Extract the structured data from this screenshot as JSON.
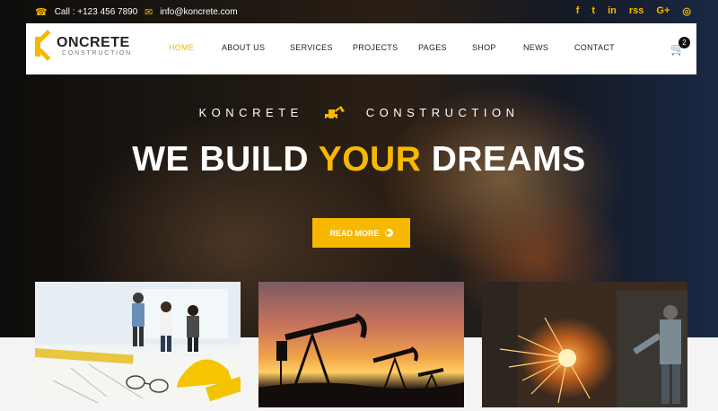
{
  "topbar": {
    "phone": "Call : +123 456 7890",
    "email": "info@koncrete.com",
    "social_icons": [
      "facebook-icon",
      "twitter-icon",
      "linkedin-icon",
      "rss-icon",
      "google-plus-icon",
      "dribbble-icon"
    ],
    "social_glyphs": [
      "f",
      "t",
      "in",
      "rss",
      "G+",
      "◎"
    ]
  },
  "logo": {
    "name": "ONCRETE",
    "sub": "CONSTRUCTION"
  },
  "nav": {
    "items": [
      {
        "label": "HOME",
        "active": true
      },
      {
        "label": "ABOUT US"
      },
      {
        "label": "SERVICES"
      },
      {
        "label": "PROJECTS"
      },
      {
        "label": "PAGES"
      },
      {
        "label": "SHOP"
      },
      {
        "label": "NEWS"
      },
      {
        "label": "CONTACT"
      }
    ],
    "cart_count": "2"
  },
  "hero": {
    "tagline_left": "KONCRETE",
    "tagline_right": "CONSTRUCTION",
    "headline_pre": "WE BUILD ",
    "headline_accent": "YOUR",
    "headline_post": " DREAMS",
    "button": "READ MORE"
  },
  "colors": {
    "accent": "#f6b800",
    "dark": "#222222"
  }
}
